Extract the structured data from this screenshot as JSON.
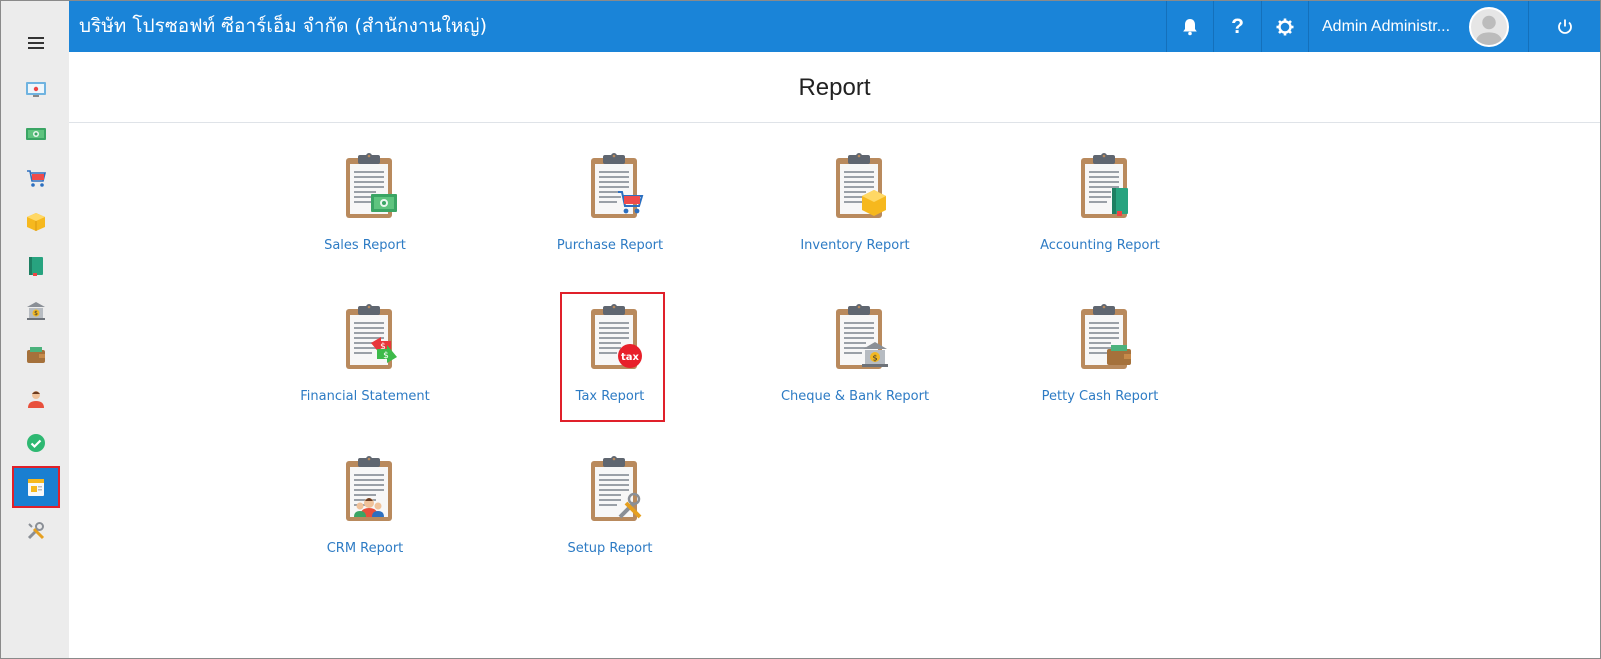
{
  "header": {
    "company": "บริษัท โปรซอฟท์ ซีอาร์เอ็ม จำกัด (สำนักงานใหญ่)",
    "user_name": "Admin Administr...",
    "help_label": "?",
    "colors": {
      "topbar": "#1a84d8",
      "link": "#2d7bc4",
      "highlight": "#e0202a"
    }
  },
  "sidebar": {
    "items": [
      {
        "icon": "dashboard-icon"
      },
      {
        "icon": "money-icon"
      },
      {
        "icon": "cart-icon"
      },
      {
        "icon": "box-icon"
      },
      {
        "icon": "book-icon"
      },
      {
        "icon": "bank-icon"
      },
      {
        "icon": "wallet-icon"
      },
      {
        "icon": "people-icon"
      },
      {
        "icon": "check-icon"
      },
      {
        "icon": "report-icon",
        "active": true
      },
      {
        "icon": "tools-icon"
      }
    ]
  },
  "main": {
    "title": "Report",
    "reports": [
      {
        "label": "Sales Report",
        "icon": "sales-report-icon"
      },
      {
        "label": "Purchase Report",
        "icon": "purchase-report-icon"
      },
      {
        "label": "Inventory Report",
        "icon": "inventory-report-icon"
      },
      {
        "label": "Accounting Report",
        "icon": "accounting-report-icon"
      },
      {
        "label": "Financial Statement",
        "icon": "financial-statement-icon"
      },
      {
        "label": "Tax Report",
        "icon": "tax-report-icon",
        "badge": "tax",
        "selected": true
      },
      {
        "label": "Cheque & Bank Report",
        "icon": "cheque-bank-report-icon"
      },
      {
        "label": "Petty Cash Report",
        "icon": "petty-cash-report-icon"
      },
      {
        "label": "CRM Report",
        "icon": "crm-report-icon"
      },
      {
        "label": "Setup Report",
        "icon": "setup-report-icon"
      }
    ]
  }
}
